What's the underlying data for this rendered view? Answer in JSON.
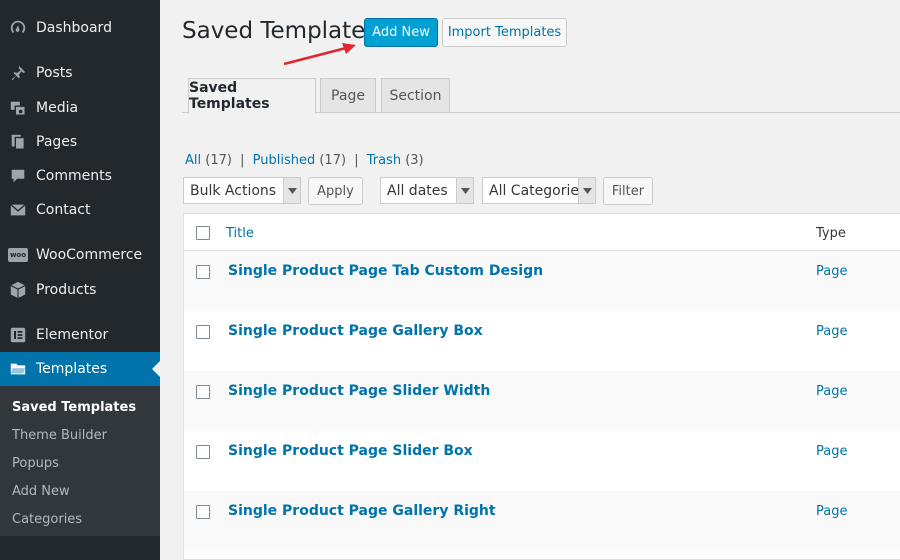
{
  "sidebar": {
    "items": [
      {
        "label": "Dashboard",
        "icon": "dashboard-icon"
      },
      {
        "label": "Posts",
        "icon": "pushpin-icon"
      },
      {
        "label": "Media",
        "icon": "media-icon"
      },
      {
        "label": "Pages",
        "icon": "pages-icon"
      },
      {
        "label": "Comments",
        "icon": "comment-icon"
      },
      {
        "label": "Contact",
        "icon": "envelope-icon"
      },
      {
        "label": "WooCommerce",
        "icon": "woocommerce-icon",
        "icon_text": "woo"
      },
      {
        "label": "Products",
        "icon": "box-icon"
      },
      {
        "label": "Elementor",
        "icon": "elementor-icon"
      },
      {
        "label": "Templates",
        "icon": "folder-icon"
      }
    ],
    "submenu": [
      "Saved Templates",
      "Theme Builder",
      "Popups",
      "Add New",
      "Categories"
    ]
  },
  "header": {
    "title": "Saved Templates",
    "add_new": "Add New",
    "import": "Import Templates"
  },
  "tabs": [
    "Saved Templates",
    "Page",
    "Section"
  ],
  "filters": {
    "all": "All",
    "all_count": "(17)",
    "published": "Published",
    "published_count": "(17)",
    "trash": "Trash",
    "trash_count": "(3)",
    "separator": "|"
  },
  "toolbar": {
    "bulk_actions": "Bulk Actions",
    "apply": "Apply",
    "dates": "All dates",
    "categories": "All Categories",
    "filter": "Filter"
  },
  "table": {
    "columns": {
      "title": "Title",
      "type": "Type"
    },
    "rows": [
      {
        "title": "Single Product Page Tab Custom Design",
        "type": "Page"
      },
      {
        "title": "Single Product Page Gallery Box",
        "type": "Page"
      },
      {
        "title": "Single Product Page Slider Width",
        "type": "Page"
      },
      {
        "title": "Single Product Page Slider Box",
        "type": "Page"
      },
      {
        "title": "Single Product Page Gallery Right",
        "type": "Page"
      }
    ]
  },
  "colors": {
    "sidebar_bg": "#23282d",
    "accent": "#0073aa",
    "primary_button": "#00a0d2",
    "arrow": "#e3262e"
  }
}
